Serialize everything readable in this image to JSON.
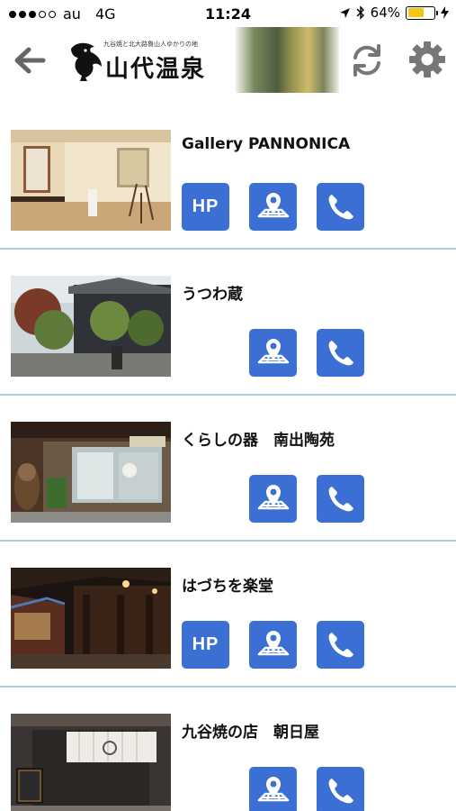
{
  "status_bar": {
    "carrier": "au",
    "network": "4G",
    "time": "11:24",
    "battery_percent": "64%",
    "battery_level": 0.64,
    "signal_bars_filled": 3,
    "signal_bars_total": 5
  },
  "header": {
    "logo_tagline": "九谷焼と北大路魯山人ゆかりの地",
    "logo_title": "山代温泉",
    "icons": [
      "back-arrow-icon",
      "refresh-icon",
      "settings-gear-icon"
    ]
  },
  "colors": {
    "button_blue": "#3b6fd3",
    "divider": "#a9cfe8",
    "battery": "#f5c518"
  },
  "list": [
    {
      "name": "Gallery PANNONICA",
      "has_hp": true,
      "hp_label": "HP"
    },
    {
      "name": "うつわ蔵",
      "has_hp": false,
      "hp_label": ""
    },
    {
      "name": "くらしの器　南出陶苑",
      "has_hp": false,
      "hp_label": ""
    },
    {
      "name": "はづちを楽堂",
      "has_hp": true,
      "hp_label": "HP"
    },
    {
      "name": "九谷焼の店　朝日屋",
      "has_hp": false,
      "hp_label": ""
    }
  ]
}
